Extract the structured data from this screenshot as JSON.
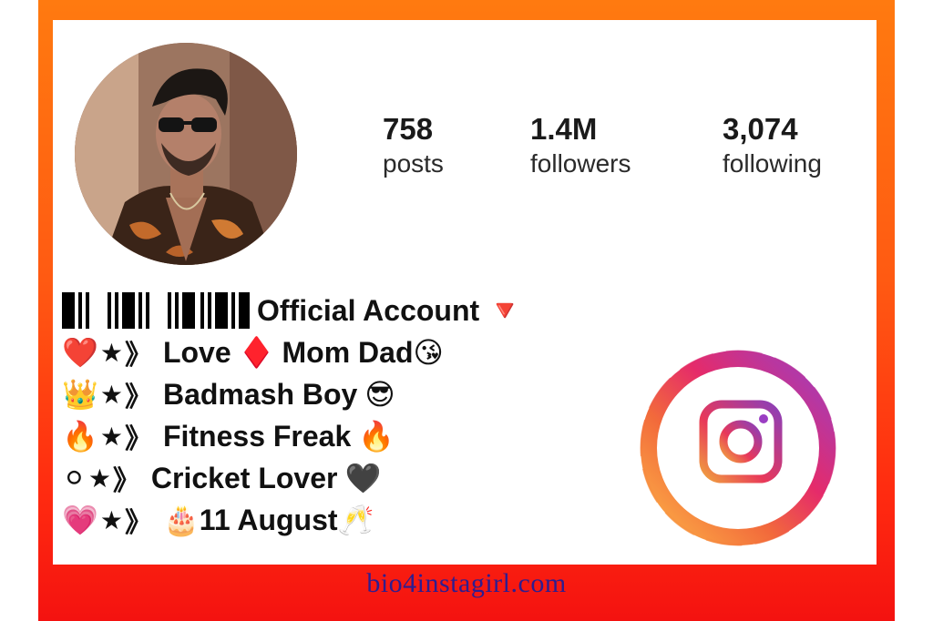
{
  "profile": {
    "stats": {
      "posts": {
        "value": "758",
        "label": "posts"
      },
      "followers": {
        "value": "1.4M",
        "label": "followers"
      },
      "following": {
        "value": "3,074",
        "label": "following"
      }
    },
    "bio": {
      "line1": {
        "text": "Official Account",
        "emoji": "🔻"
      },
      "line2": {
        "lead": "❤️",
        "star": "★",
        "chev": "》",
        "text_a": "Love",
        "mid": "♦️",
        "text_b": "Mom Dad",
        "end": "😘"
      },
      "line3": {
        "lead": "👑",
        "star": "★",
        "chev": "》",
        "text": "Badmash Boy",
        "end": "😎"
      },
      "line4": {
        "lead": "🔥",
        "star": "★",
        "chev": "》",
        "text": "Fitness Freak",
        "end": "🔥"
      },
      "line5": {
        "lead": "⚪",
        "star": "★",
        "chev": "》",
        "text": "Cricket Lover",
        "end": "🖤"
      },
      "line6": {
        "lead": "💗",
        "star": "★",
        "chev": "》",
        "cake": "🎂",
        "text": "11 August",
        "end": "🥂"
      }
    }
  },
  "footer": {
    "website": "bio4instagirl.com"
  },
  "colors": {
    "frame_top": "#ff7a10",
    "frame_bottom": "#f41210",
    "footer_text": "#2f1d8f"
  },
  "icons": {
    "instagram": "instagram-icon"
  }
}
